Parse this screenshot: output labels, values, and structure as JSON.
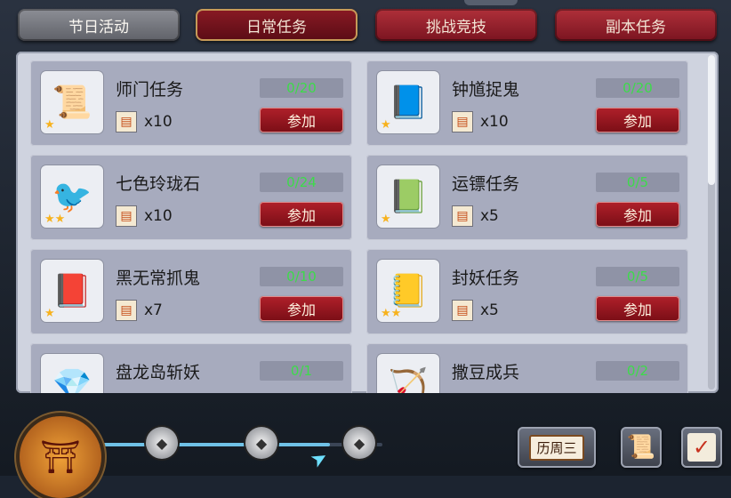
{
  "tabs": [
    {
      "label": "节日活动",
      "style": "gray"
    },
    {
      "label": "日常任务",
      "style": "active"
    },
    {
      "label": "挑战竞技",
      "style": "red"
    },
    {
      "label": "副本任务",
      "style": "red"
    }
  ],
  "tasks": [
    {
      "name": "师门任务",
      "progress": "0/20",
      "reward_count": "x10",
      "join_label": "参加",
      "icon": "scroll-icon",
      "stars": 1
    },
    {
      "name": "钟馗捉鬼",
      "progress": "0/20",
      "reward_count": "x10",
      "join_label": "参加",
      "icon": "ghost-book-icon",
      "stars": 1
    },
    {
      "name": "七色玲珑石",
      "progress": "0/24",
      "reward_count": "x10",
      "join_label": "参加",
      "icon": "toucan-icon",
      "stars": 2
    },
    {
      "name": "运镖任务",
      "progress": "0/5",
      "reward_count": "x5",
      "join_label": "参加",
      "icon": "blue-book-icon",
      "stars": 1
    },
    {
      "name": "黑无常抓鬼",
      "progress": "0/10",
      "reward_count": "x7",
      "join_label": "参加",
      "icon": "seal-book-icon",
      "stars": 1
    },
    {
      "name": "封妖任务",
      "progress": "0/5",
      "reward_count": "x5",
      "join_label": "参加",
      "icon": "purple-book-icon",
      "stars": 2
    },
    {
      "name": "盘龙岛斩妖",
      "progress": "0/1",
      "reward_count": "",
      "join_label": "",
      "icon": "gems-icon",
      "stars": 0
    },
    {
      "name": "撒豆成兵",
      "progress": "0/2",
      "reward_count": "",
      "join_label": "",
      "icon": "arrows-icon",
      "stars": 0
    }
  ],
  "bottom": {
    "calendar_label": "历周三",
    "track_progress": 0.82
  },
  "colors": {
    "progress_text": "#3ddb4a",
    "join_button": "#9a1822",
    "panel_bg": "#cfd3df",
    "card_bg": "#a7abbe"
  }
}
